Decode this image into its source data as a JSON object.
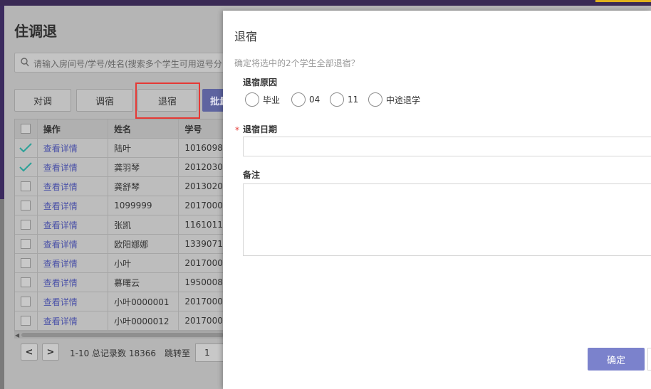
{
  "page": {
    "title": "住调退",
    "search_placeholder": "请输入房间号/学号/姓名(搜索多个学生可用逗号分",
    "toolbar": {
      "duidiao_label": "对调",
      "tiaosu_label": "调宿",
      "tuisu_label": "退宿",
      "batch_label": "批量"
    }
  },
  "table": {
    "columns": [
      "操作",
      "姓名",
      "学号"
    ],
    "rows": [
      {
        "checked": true,
        "action": "查看详情",
        "name": "陆叶",
        "id": "1016098"
      },
      {
        "checked": true,
        "action": "查看详情",
        "name": "龚羽琴",
        "id": "2012030"
      },
      {
        "checked": false,
        "action": "查看详情",
        "name": "龚舒琴",
        "id": "2013020"
      },
      {
        "checked": false,
        "action": "查看详情",
        "name": "1099999",
        "id": "2017000"
      },
      {
        "checked": false,
        "action": "查看详情",
        "name": "张凯",
        "id": "1161011"
      },
      {
        "checked": false,
        "action": "查看详情",
        "name": "欧阳娜娜",
        "id": "1339071"
      },
      {
        "checked": false,
        "action": "查看详情",
        "name": "小叶",
        "id": "2017000"
      },
      {
        "checked": false,
        "action": "查看详情",
        "name": "慕曙云",
        "id": "1950008"
      },
      {
        "checked": false,
        "action": "查看详情",
        "name": "小叶0000001",
        "id": "2017000"
      },
      {
        "checked": false,
        "action": "查看详情",
        "name": "小叶0000012",
        "id": "2017000"
      }
    ]
  },
  "pagination": {
    "prev_icon": "<",
    "next_icon": ">",
    "info": "1-10 总记录数 18366",
    "jump_label": "跳转至",
    "jump_value": "1"
  },
  "modal": {
    "title": "退宿",
    "confirm_text": "确定将选中的2个学生全部退宿？",
    "reason_label": "退宿原因",
    "reasons": [
      "毕业",
      "04",
      "11",
      "中途退学"
    ],
    "required_mark": "*",
    "date_label": "退宿日期",
    "note_label": "备注",
    "ok_label": "确定"
  },
  "colors": {
    "primary": "#7b82cc",
    "highlight": "#e53935",
    "check": "#2aa198"
  }
}
